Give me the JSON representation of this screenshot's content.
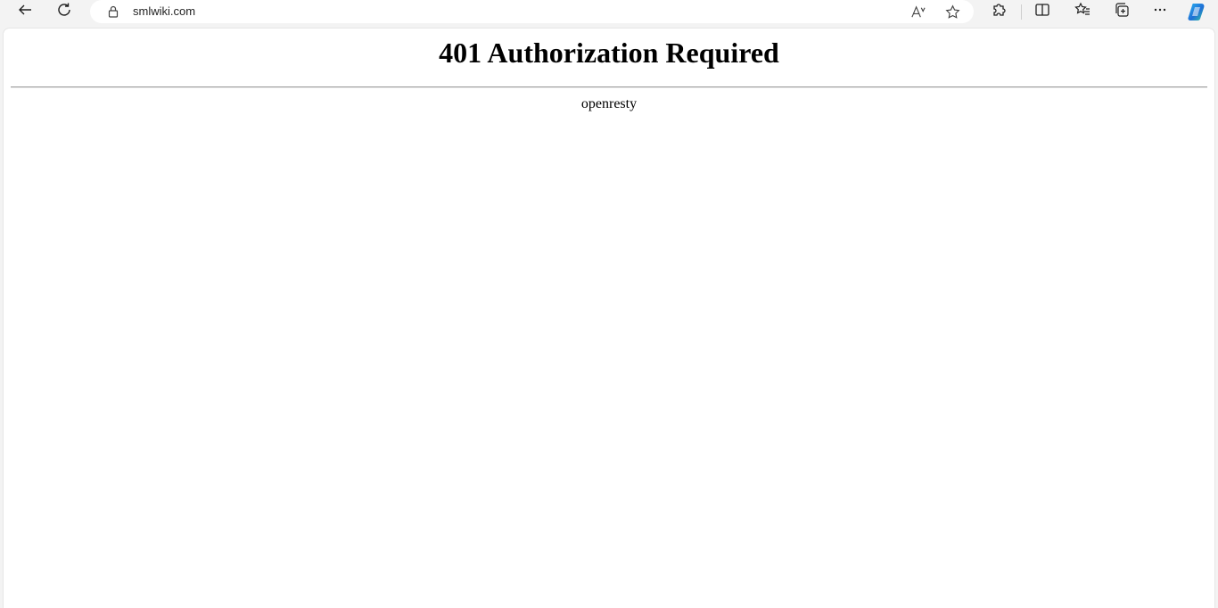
{
  "browser": {
    "address_bar": {
      "url": "smlwiki.com"
    },
    "toolbar_icons": [
      "back-icon",
      "refresh-icon",
      "lock-icon",
      "read-aloud-icon",
      "favorite-star-icon",
      "extensions-icon",
      "split-screen-icon",
      "favorites-icon",
      "collections-icon",
      "more-icon",
      "copilot-icon"
    ],
    "accent_color": "#1f6fd6"
  },
  "page": {
    "title": "401 Authorization Required",
    "server": "openresty"
  }
}
